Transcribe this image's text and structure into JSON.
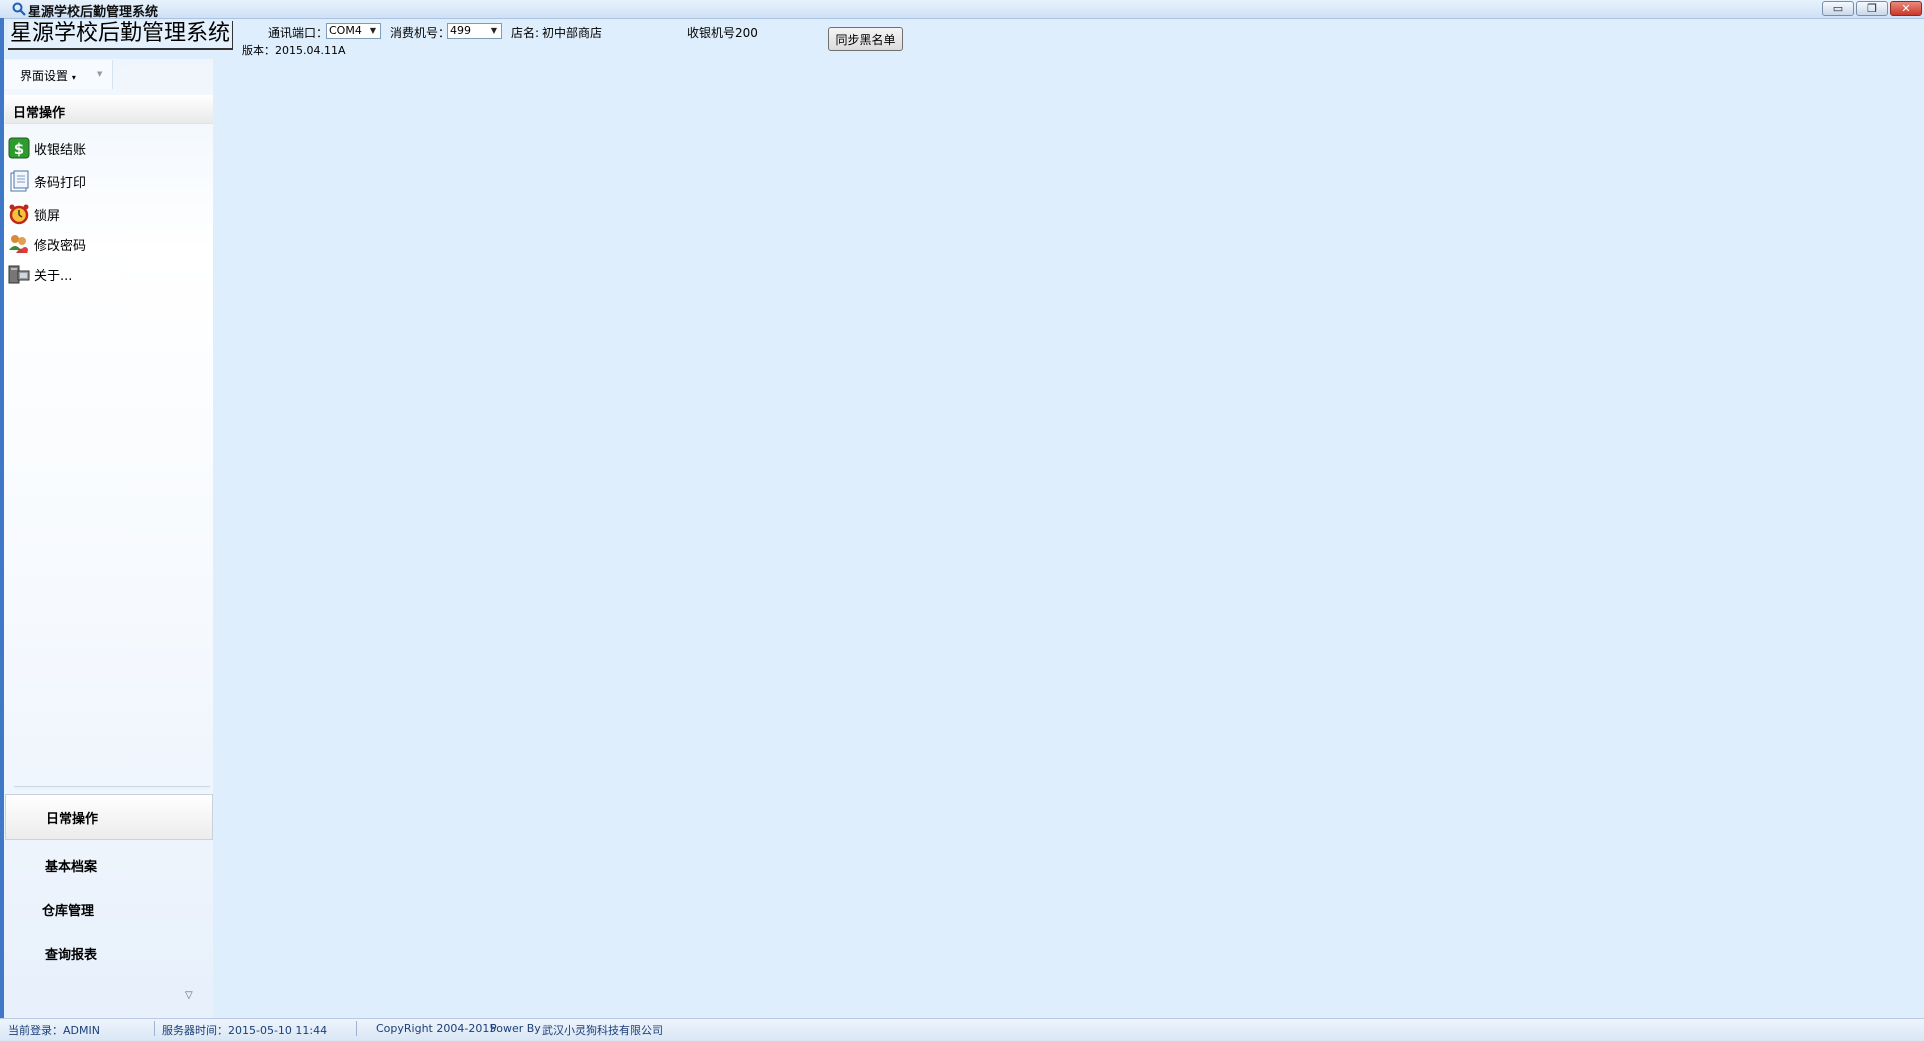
{
  "window": {
    "title": "星源学校后勤管理系统",
    "minimize_symbol": "▭",
    "restore_symbol": "❐",
    "close_symbol": "✕"
  },
  "header": {
    "app_title": "星源学校后勤管理系统",
    "version": "版本：2015.04.11A",
    "port_label": "通讯端口：",
    "port_value": "COM4",
    "terminal_label": "消费机号：",
    "terminal_value": "499",
    "store_label": "店名:",
    "store_value": "初中部商店",
    "cashier_label": "收银机号200",
    "sync_button": "同步黑名单"
  },
  "menu": {
    "ui_settings": "界面设置"
  },
  "nav": {
    "group_title": "日常操作",
    "items": [
      {
        "label": "收银结账",
        "icon": "dollar-icon"
      },
      {
        "label": "条码打印",
        "icon": "document-icon"
      },
      {
        "label": "锁屏",
        "icon": "alarm-clock-icon"
      },
      {
        "label": "修改密码",
        "icon": "users-key-icon"
      },
      {
        "label": "关于...",
        "icon": "computer-icon"
      }
    ],
    "categories": [
      "日常操作",
      "基本档案",
      "仓库管理",
      "查询报表"
    ],
    "active_category": "日常操作"
  },
  "status": {
    "current_user": "当前登录：ADMIN",
    "server_time": "服务器时间：2015-05-10 11:44",
    "copyright": "CopyRight 2004-2015",
    "powered_by": "Power By",
    "company": "武汉小灵狗科技有限公司"
  },
  "colors": {
    "background": "#dfeefc",
    "window_rim": "#3e78c7",
    "status_text": "#1a3f78"
  }
}
